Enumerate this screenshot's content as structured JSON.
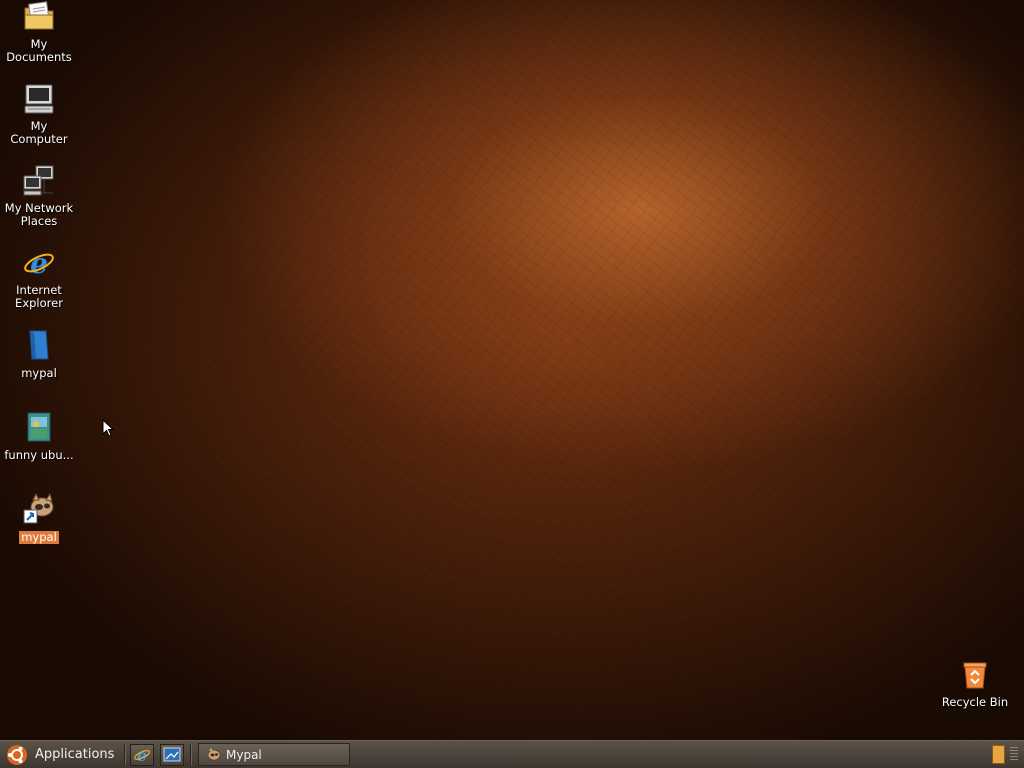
{
  "desktop": {
    "icons": [
      {
        "label": "My Documents",
        "icon": "folder-documents-icon"
      },
      {
        "label": "My Computer",
        "icon": "computer-icon"
      },
      {
        "label": "My Network Places",
        "icon": "network-places-icon"
      },
      {
        "label": "Internet Explorer",
        "icon": "internet-explorer-icon"
      },
      {
        "label": "mypal",
        "icon": "mypal-folder-icon"
      },
      {
        "label": "funny ubu...",
        "icon": "funny-ubuntu-file-icon"
      },
      {
        "label": "mypal",
        "icon": "mypal-shortcut-icon",
        "selected": true
      }
    ],
    "recycle_bin": {
      "label": "Recycle Bin",
      "icon": "recycle-bin-icon"
    }
  },
  "taskbar": {
    "applications_label": "Applications",
    "launchers": [
      "internet-explorer-icon",
      "show-desktop-icon"
    ],
    "tasks": [
      {
        "label": "Mypal",
        "icon": "mypal-icon"
      }
    ],
    "tray": [
      "notes-icon",
      "tray-grip-icon"
    ]
  },
  "colors": {
    "taskbar_bg": "#4a4239",
    "selection": "#e07a3a",
    "wallpaper": "#7a3a14"
  }
}
